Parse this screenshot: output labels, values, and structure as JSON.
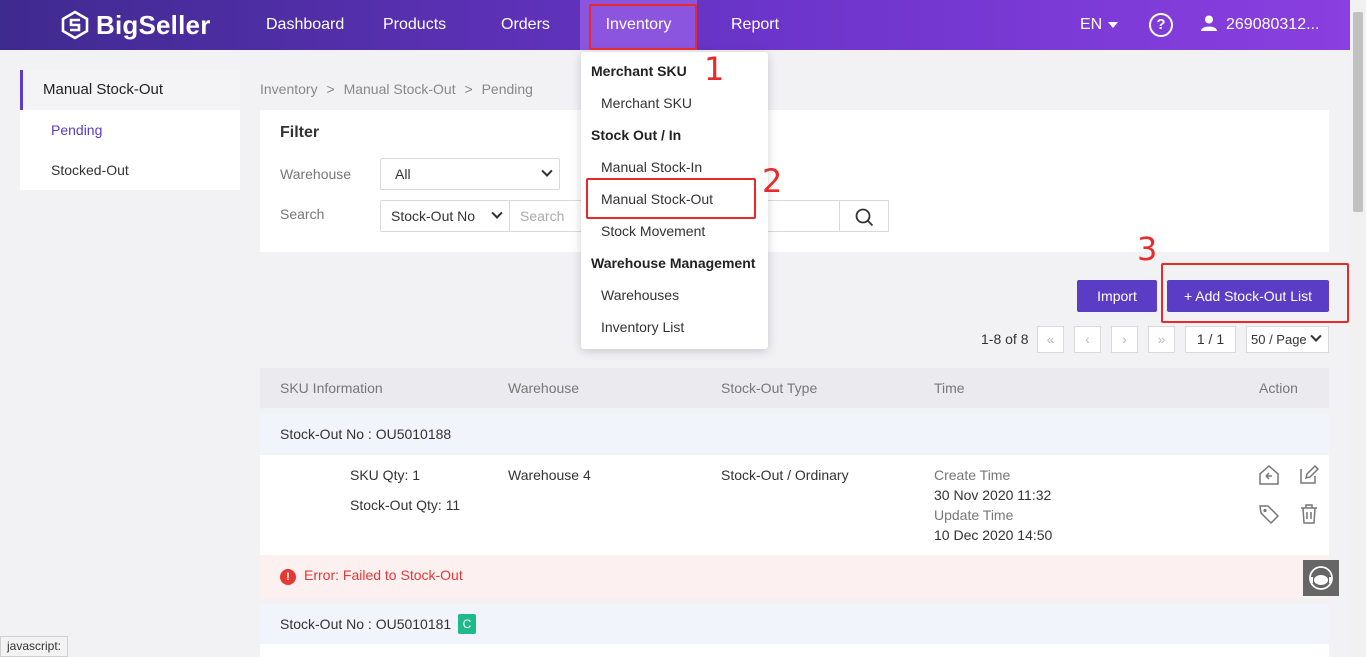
{
  "brand": {
    "name": "BigSeller"
  },
  "nav": {
    "items": [
      "Dashboard",
      "Products",
      "Orders",
      "Inventory",
      "Report"
    ],
    "language": "EN",
    "user": "269080312..."
  },
  "sidebar": {
    "title": "Manual Stock-Out",
    "items": [
      "Pending",
      "Stocked-Out"
    ]
  },
  "breadcrumb": [
    "Inventory",
    ">",
    "Manual Stock-Out",
    ">",
    "Pending"
  ],
  "filter": {
    "title": "Filter",
    "warehouse_label": "Warehouse",
    "warehouse_value": "All",
    "search_label": "Search",
    "search_type": "Stock-Out No",
    "search_placeholder": "Search"
  },
  "actions": {
    "import": "Import",
    "add": "+ Add Stock-Out List"
  },
  "pagination": {
    "summary": "1-8 of 8",
    "first": "«",
    "prev": "‹",
    "next": "›",
    "last": "»",
    "page": "1 / 1",
    "page_size": "50 / Page"
  },
  "table": {
    "headers": [
      "SKU Information",
      "Warehouse",
      "Stock-Out Type",
      "Time",
      "Action"
    ],
    "groups": [
      {
        "stockout_no": "Stock-Out No : OU5010188",
        "sku_qty": "SKU Qty: 1",
        "stockout_qty": "Stock-Out Qty: 11",
        "warehouse": "Warehouse 4",
        "type": "Stock-Out / Ordinary",
        "create_label": "Create Time",
        "create_time": "30 Nov 2020 11:32",
        "update_label": "Update Time",
        "update_time": "10 Dec 2020 14:50",
        "error": "Error: Failed to Stock-Out"
      },
      {
        "stockout_no": "Stock-Out No : OU5010181",
        "badge": "C"
      }
    ]
  },
  "dropdown": {
    "groups": [
      {
        "title": "Merchant SKU",
        "items": [
          "Merchant SKU"
        ]
      },
      {
        "title": "Stock Out / In",
        "items": [
          "Manual Stock-In",
          "Manual Stock-Out",
          "Stock Movement"
        ]
      },
      {
        "title": "Warehouse Management",
        "items": [
          "Warehouses",
          "Inventory List"
        ]
      }
    ]
  },
  "annotations": [
    "1",
    "2",
    "3"
  ],
  "status_bar": "javascript:",
  "colors": {
    "brand": "#5b3cc4",
    "annotation": "#e82a2a",
    "error": "#e53935",
    "badge": "#1fb98a"
  }
}
